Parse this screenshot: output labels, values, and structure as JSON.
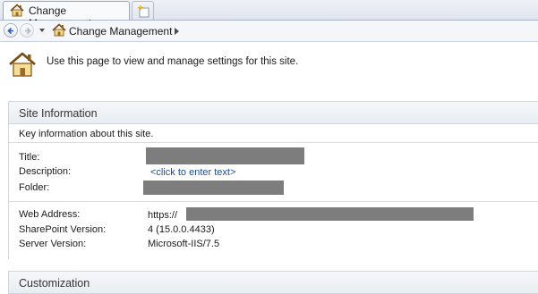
{
  "tab": {
    "title": "Change Management"
  },
  "breadcrumb": {
    "label": "Change Management"
  },
  "intro": {
    "text": "Use this page to view and manage settings for this site."
  },
  "site_info": {
    "title": "Site Information",
    "subheader": "Key information about this site.",
    "labels": {
      "title": "Title:",
      "description": "Description:",
      "folder": "Folder:",
      "web_address": "Web Address:",
      "sp_version": "SharePoint Version:",
      "server_version": "Server Version:"
    },
    "values": {
      "description_link": "<click to enter text>",
      "web_address_prefix": "https://",
      "sp_version": "4 (15.0.0.4433)",
      "server_version": "Microsoft-IIS/7.5"
    }
  },
  "customization": {
    "title": "Customization"
  },
  "icons": [
    "home-icon",
    "new-tab-icon",
    "back-arrow-icon",
    "forward-arrow-icon",
    "chevron-down-icon",
    "chevron-right-icon"
  ]
}
